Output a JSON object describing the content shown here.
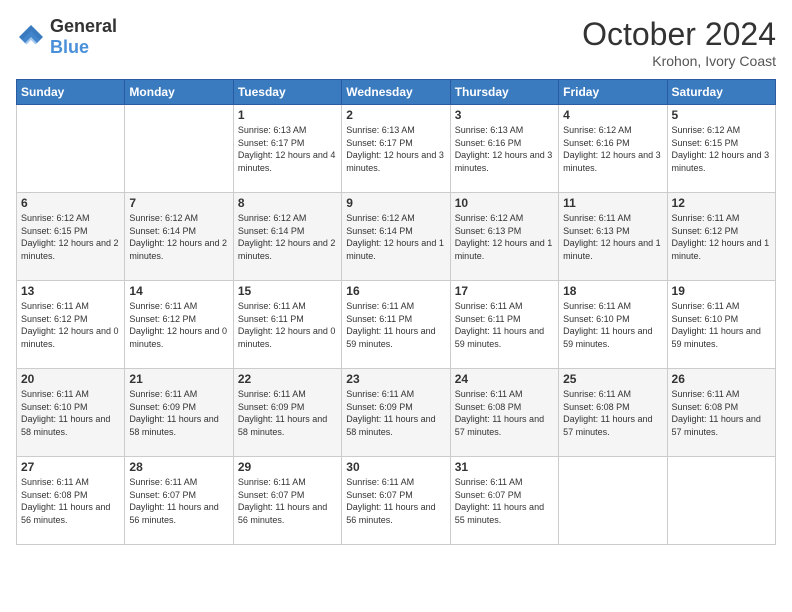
{
  "header": {
    "logo_general": "General",
    "logo_blue": "Blue",
    "month_title": "October 2024",
    "location": "Krohon, Ivory Coast"
  },
  "weekdays": [
    "Sunday",
    "Monday",
    "Tuesday",
    "Wednesday",
    "Thursday",
    "Friday",
    "Saturday"
  ],
  "weeks": [
    [
      {
        "day": "",
        "info": ""
      },
      {
        "day": "",
        "info": ""
      },
      {
        "day": "1",
        "info": "Sunrise: 6:13 AM\nSunset: 6:17 PM\nDaylight: 12 hours\nand 4 minutes."
      },
      {
        "day": "2",
        "info": "Sunrise: 6:13 AM\nSunset: 6:17 PM\nDaylight: 12 hours\nand 3 minutes."
      },
      {
        "day": "3",
        "info": "Sunrise: 6:13 AM\nSunset: 6:16 PM\nDaylight: 12 hours\nand 3 minutes."
      },
      {
        "day": "4",
        "info": "Sunrise: 6:12 AM\nSunset: 6:16 PM\nDaylight: 12 hours\nand 3 minutes."
      },
      {
        "day": "5",
        "info": "Sunrise: 6:12 AM\nSunset: 6:15 PM\nDaylight: 12 hours\nand 3 minutes."
      }
    ],
    [
      {
        "day": "6",
        "info": "Sunrise: 6:12 AM\nSunset: 6:15 PM\nDaylight: 12 hours\nand 2 minutes."
      },
      {
        "day": "7",
        "info": "Sunrise: 6:12 AM\nSunset: 6:14 PM\nDaylight: 12 hours\nand 2 minutes."
      },
      {
        "day": "8",
        "info": "Sunrise: 6:12 AM\nSunset: 6:14 PM\nDaylight: 12 hours\nand 2 minutes."
      },
      {
        "day": "9",
        "info": "Sunrise: 6:12 AM\nSunset: 6:14 PM\nDaylight: 12 hours\nand 1 minute."
      },
      {
        "day": "10",
        "info": "Sunrise: 6:12 AM\nSunset: 6:13 PM\nDaylight: 12 hours\nand 1 minute."
      },
      {
        "day": "11",
        "info": "Sunrise: 6:11 AM\nSunset: 6:13 PM\nDaylight: 12 hours\nand 1 minute."
      },
      {
        "day": "12",
        "info": "Sunrise: 6:11 AM\nSunset: 6:12 PM\nDaylight: 12 hours\nand 1 minute."
      }
    ],
    [
      {
        "day": "13",
        "info": "Sunrise: 6:11 AM\nSunset: 6:12 PM\nDaylight: 12 hours\nand 0 minutes."
      },
      {
        "day": "14",
        "info": "Sunrise: 6:11 AM\nSunset: 6:12 PM\nDaylight: 12 hours\nand 0 minutes."
      },
      {
        "day": "15",
        "info": "Sunrise: 6:11 AM\nSunset: 6:11 PM\nDaylight: 12 hours\nand 0 minutes."
      },
      {
        "day": "16",
        "info": "Sunrise: 6:11 AM\nSunset: 6:11 PM\nDaylight: 11 hours\nand 59 minutes."
      },
      {
        "day": "17",
        "info": "Sunrise: 6:11 AM\nSunset: 6:11 PM\nDaylight: 11 hours\nand 59 minutes."
      },
      {
        "day": "18",
        "info": "Sunrise: 6:11 AM\nSunset: 6:10 PM\nDaylight: 11 hours\nand 59 minutes."
      },
      {
        "day": "19",
        "info": "Sunrise: 6:11 AM\nSunset: 6:10 PM\nDaylight: 11 hours\nand 59 minutes."
      }
    ],
    [
      {
        "day": "20",
        "info": "Sunrise: 6:11 AM\nSunset: 6:10 PM\nDaylight: 11 hours\nand 58 minutes."
      },
      {
        "day": "21",
        "info": "Sunrise: 6:11 AM\nSunset: 6:09 PM\nDaylight: 11 hours\nand 58 minutes."
      },
      {
        "day": "22",
        "info": "Sunrise: 6:11 AM\nSunset: 6:09 PM\nDaylight: 11 hours\nand 58 minutes."
      },
      {
        "day": "23",
        "info": "Sunrise: 6:11 AM\nSunset: 6:09 PM\nDaylight: 11 hours\nand 58 minutes."
      },
      {
        "day": "24",
        "info": "Sunrise: 6:11 AM\nSunset: 6:08 PM\nDaylight: 11 hours\nand 57 minutes."
      },
      {
        "day": "25",
        "info": "Sunrise: 6:11 AM\nSunset: 6:08 PM\nDaylight: 11 hours\nand 57 minutes."
      },
      {
        "day": "26",
        "info": "Sunrise: 6:11 AM\nSunset: 6:08 PM\nDaylight: 11 hours\nand 57 minutes."
      }
    ],
    [
      {
        "day": "27",
        "info": "Sunrise: 6:11 AM\nSunset: 6:08 PM\nDaylight: 11 hours\nand 56 minutes."
      },
      {
        "day": "28",
        "info": "Sunrise: 6:11 AM\nSunset: 6:07 PM\nDaylight: 11 hours\nand 56 minutes."
      },
      {
        "day": "29",
        "info": "Sunrise: 6:11 AM\nSunset: 6:07 PM\nDaylight: 11 hours\nand 56 minutes."
      },
      {
        "day": "30",
        "info": "Sunrise: 6:11 AM\nSunset: 6:07 PM\nDaylight: 11 hours\nand 56 minutes."
      },
      {
        "day": "31",
        "info": "Sunrise: 6:11 AM\nSunset: 6:07 PM\nDaylight: 11 hours\nand 55 minutes."
      },
      {
        "day": "",
        "info": ""
      },
      {
        "day": "",
        "info": ""
      }
    ]
  ]
}
